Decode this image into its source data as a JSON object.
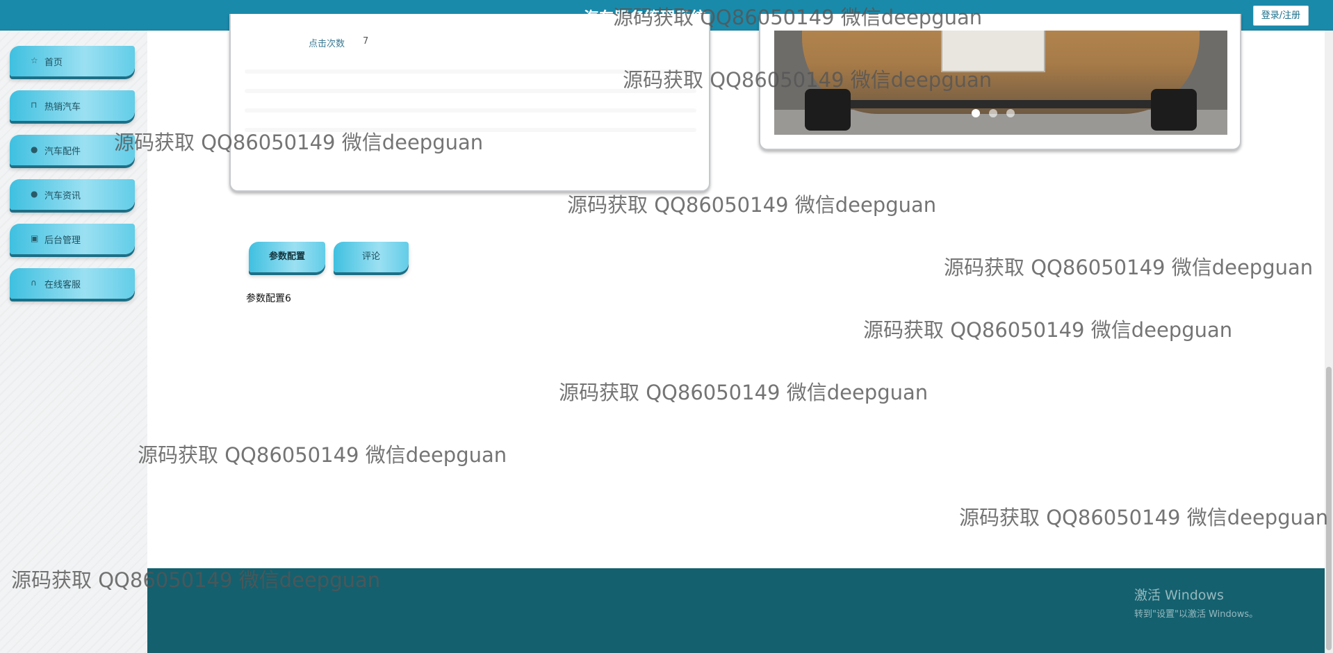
{
  "header": {
    "title": "汽车服务管理系统",
    "login_label": "登录/注册"
  },
  "sidebar": {
    "items": [
      {
        "label": "首页",
        "icon": "star-icon"
      },
      {
        "label": "热销汽车",
        "icon": "bag-icon"
      },
      {
        "label": "汽车配件",
        "icon": "info-circle-icon"
      },
      {
        "label": "汽车资讯",
        "icon": "question-circle-icon"
      },
      {
        "label": "后台管理",
        "icon": "briefcase-icon"
      },
      {
        "label": "在线客服",
        "icon": "headset-icon"
      }
    ]
  },
  "detail": {
    "clicks_label": "点击次数",
    "clicks_value": "7"
  },
  "carousel": {
    "slide_count": 3,
    "active_index": 0
  },
  "tabs": {
    "params_label": "参数配置",
    "comments_label": "评论",
    "content": "参数配置6"
  },
  "watermark": {
    "text": "源码获取 QQ86050149 微信deepguan"
  },
  "os_overlay": {
    "line1": "激活 Windows",
    "line2": "转到\"设置\"以激活 Windows。"
  }
}
